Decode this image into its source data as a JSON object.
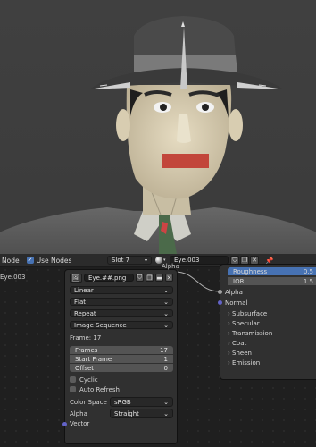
{
  "header": {
    "editor_type_label": "Node",
    "use_nodes_label": "Use Nodes",
    "slot": "Slot 7",
    "material_name": "Eye.003"
  },
  "left_label": "Eye.003",
  "image_node": {
    "image_name": "Eye.##.png",
    "interpolation": "Linear",
    "projection": "Flat",
    "extension": "Repeat",
    "source": "Image Sequence",
    "frame_label": "Frame: 17",
    "frames_label": "Frames",
    "frames_value": "17",
    "start_frame_label": "Start Frame",
    "start_frame_value": "1",
    "offset_label": "Offset",
    "offset_value": "0",
    "cyclic_label": "Cyclic",
    "auto_refresh_label": "Auto Refresh",
    "color_space_label": "Color Space",
    "color_space_value": "sRGB",
    "alpha_label": "Alpha",
    "alpha_value": "Straight",
    "vector_label": "Vector",
    "top_edge_label": "Alpha"
  },
  "bsdf_node": {
    "roughness_label": "Roughness",
    "roughness_value": "0.5",
    "ior_label": "IOR",
    "ior_value": "1.5",
    "alpha_label": "Alpha",
    "normal_label": "Normal",
    "panels": [
      "Subsurface",
      "Specular",
      "Transmission",
      "Coat",
      "Sheen",
      "Emission"
    ]
  },
  "colors": {
    "accent": "#4772b3",
    "socket_grey": "#a1a1a1",
    "socket_vector": "#6363c7"
  }
}
